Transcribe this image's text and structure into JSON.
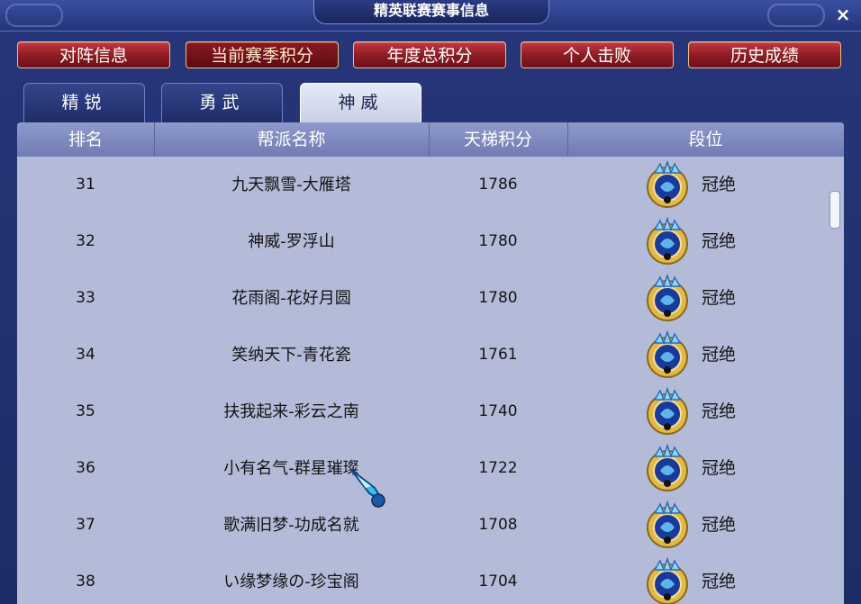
{
  "window": {
    "title": "精英联赛赛事信息",
    "close_label": "×"
  },
  "nav": [
    {
      "label": "对阵信息",
      "active": false
    },
    {
      "label": "当前赛季积分",
      "active": true
    },
    {
      "label": "年度总积分",
      "active": false
    },
    {
      "label": "个人击败",
      "active": false
    },
    {
      "label": "历史成绩",
      "active": false
    }
  ],
  "tabs": [
    {
      "label": "精锐",
      "active": false
    },
    {
      "label": "勇武",
      "active": false
    },
    {
      "label": "神威",
      "active": true
    }
  ],
  "table": {
    "columns": [
      "排名",
      "帮派名称",
      "天梯积分",
      "段位"
    ],
    "rows": [
      {
        "rank": "31",
        "name": "九天飘雪-大雁塔",
        "score": "1786",
        "tier": "冠绝",
        "badge_icon": "crown-tier-badge-icon"
      },
      {
        "rank": "32",
        "name": "神威-罗浮山",
        "score": "1780",
        "tier": "冠绝",
        "badge_icon": "crown-tier-badge-icon"
      },
      {
        "rank": "33",
        "name": "花雨阁-花好月圆",
        "score": "1780",
        "tier": "冠绝",
        "badge_icon": "crown-tier-badge-icon"
      },
      {
        "rank": "34",
        "name": "笑纳天下-青花瓷",
        "score": "1761",
        "tier": "冠绝",
        "badge_icon": "crown-tier-badge-icon"
      },
      {
        "rank": "35",
        "name": "扶我起来-彩云之南",
        "score": "1740",
        "tier": "冠绝",
        "badge_icon": "crown-tier-badge-icon"
      },
      {
        "rank": "36",
        "name": "小有名气-群星璀璨",
        "score": "1722",
        "tier": "冠绝",
        "badge_icon": "crown-tier-badge-icon"
      },
      {
        "rank": "37",
        "name": "歌满旧梦-功成名就",
        "score": "1708",
        "tier": "冠绝",
        "badge_icon": "crown-tier-badge-icon"
      },
      {
        "rank": "38",
        "name": "い缘梦缘の-珍宝阁",
        "score": "1704",
        "tier": "冠绝",
        "badge_icon": "crown-tier-badge-icon"
      }
    ]
  },
  "colors": {
    "frame": "#26367a",
    "nav_button": "#a6222c",
    "panel": "#b3bbd8",
    "header": "#7f8abf",
    "active_tab": "#dfe4f3"
  }
}
